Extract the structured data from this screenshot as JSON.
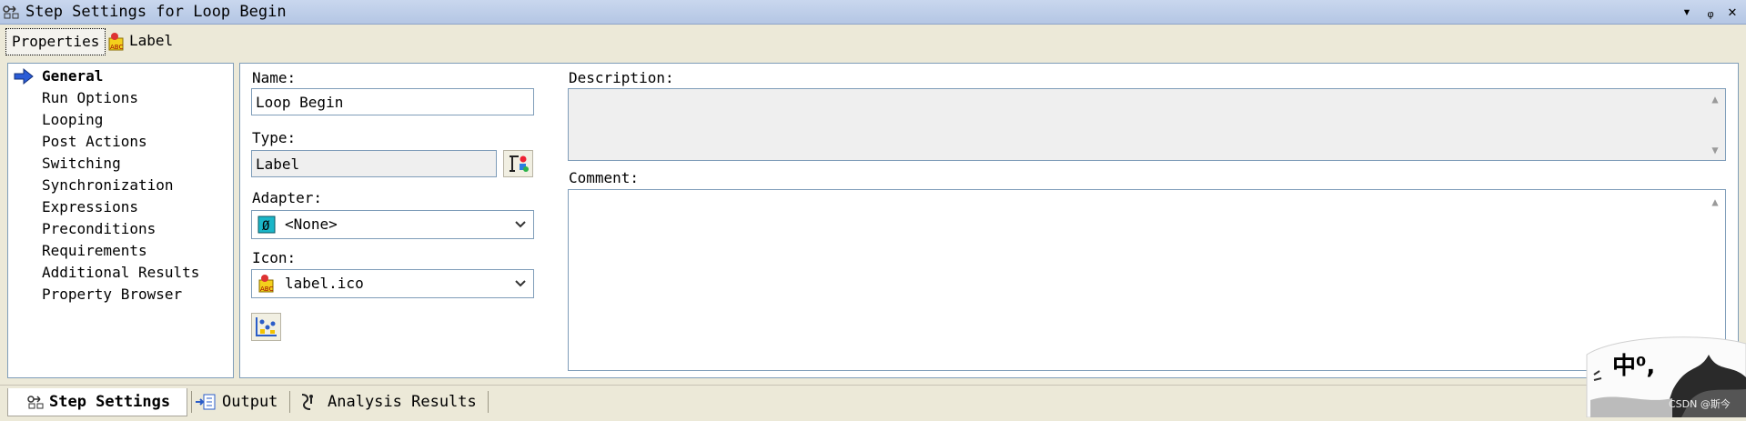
{
  "window": {
    "title": "Step Settings for Loop Begin",
    "controls": {
      "dropdown": "▾",
      "pin": "ᵩ",
      "close": "✕"
    }
  },
  "tabs": [
    {
      "label": "Properties"
    },
    {
      "label": "Label"
    }
  ],
  "nav": {
    "items": [
      {
        "label": "General",
        "selected": true
      },
      {
        "label": "Run Options"
      },
      {
        "label": "Looping"
      },
      {
        "label": "Post Actions"
      },
      {
        "label": "Switching"
      },
      {
        "label": "Synchronization"
      },
      {
        "label": "Expressions"
      },
      {
        "label": "Preconditions"
      },
      {
        "label": "Requirements"
      },
      {
        "label": "Additional Results"
      },
      {
        "label": "Property Browser"
      }
    ]
  },
  "form": {
    "name_label": "Name:",
    "name_value": "Loop Begin",
    "type_label": "Type:",
    "type_value": "Label",
    "adapter_label": "Adapter:",
    "adapter_value": "<None>",
    "icon_label": "Icon:",
    "icon_value": "label.ico",
    "description_label": "Description:",
    "description_value": "",
    "comment_label": "Comment:",
    "comment_value": ""
  },
  "bottom_tabs": [
    {
      "label": "Step Settings",
      "active": true
    },
    {
      "label": "Output"
    },
    {
      "label": "Analysis Results"
    }
  ],
  "watermark": {
    "text": "中⁰,",
    "small": "CSDN @斯今"
  },
  "colors": {
    "titlebar": "#b4c6e4",
    "background": "#ece9d8",
    "field_border": "#7f9db9",
    "nav_arrow": "#2b5cd6"
  }
}
